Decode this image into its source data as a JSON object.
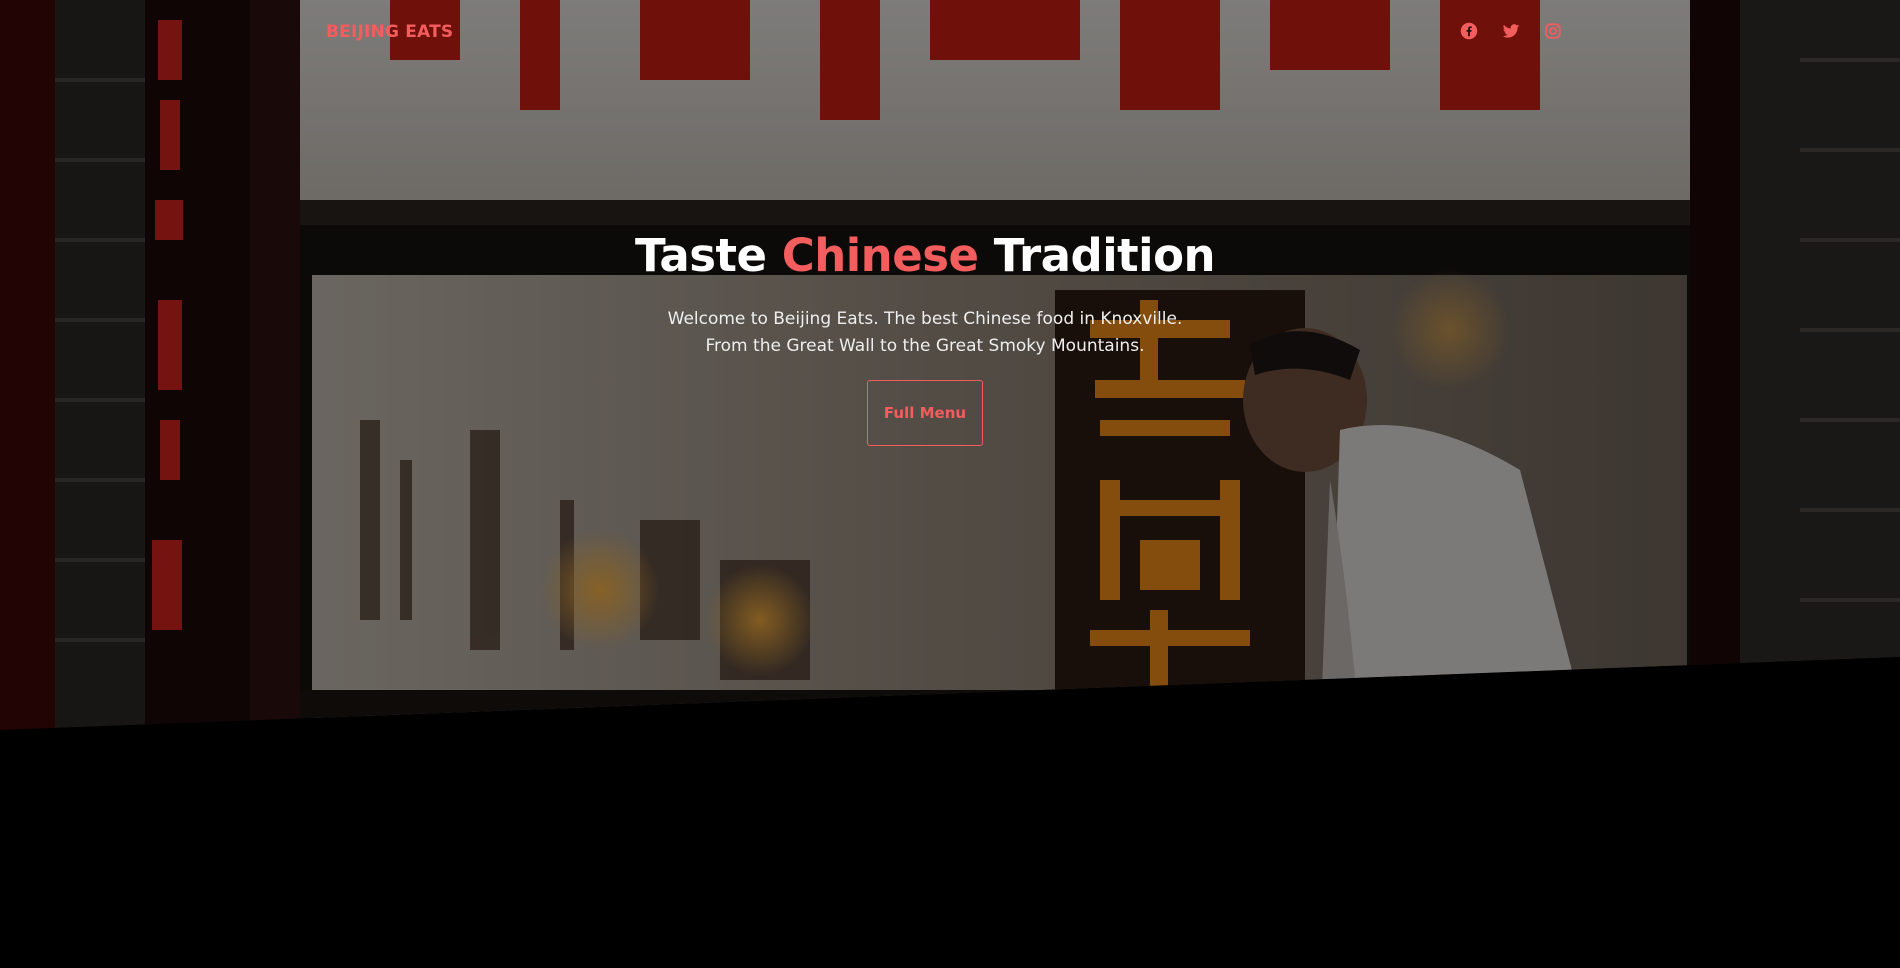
{
  "brand": {
    "name": "BEIJING EATS"
  },
  "nav": {
    "socials": [
      {
        "icon": "facebook-icon",
        "label": "Facebook"
      },
      {
        "icon": "twitter-icon",
        "label": "Twitter"
      },
      {
        "icon": "instagram-icon",
        "label": "Instagram"
      }
    ]
  },
  "hero": {
    "headline_part1": "Taste ",
    "headline_accent": "Chinese",
    "headline_part2": " Tradition",
    "subtitle_line1": "Welcome to Beijing Eats. The best Chinese food in Knoxville.",
    "subtitle_line2": "From the Great Wall to the Great Smoky Mountains.",
    "cta_label": "Full Menu"
  },
  "colors": {
    "accent": "#f35d5d",
    "background": "#000000",
    "text": "#ffffff"
  }
}
